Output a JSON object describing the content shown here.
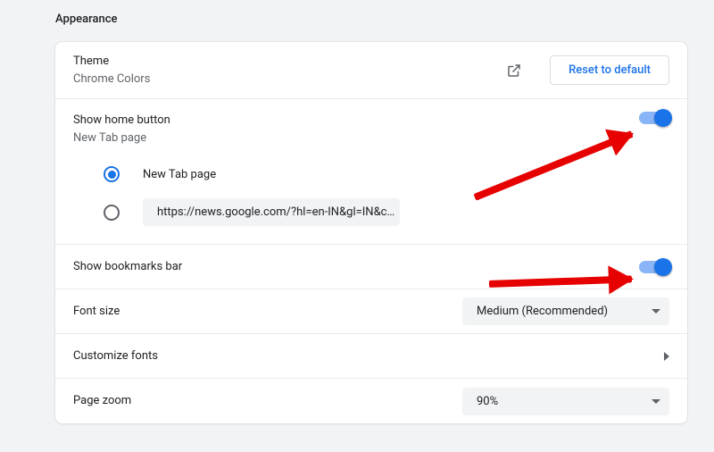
{
  "section_title": "Appearance",
  "theme": {
    "title": "Theme",
    "subtitle": "Chrome Colors",
    "reset_label": "Reset to default"
  },
  "home": {
    "title": "Show home button",
    "subtitle": "New Tab page",
    "toggle_on": true,
    "options": {
      "newtab_label": "New Tab page",
      "url_value": "https://news.google.com/?hl=en-IN&gl=IN&c…",
      "selected": "newtab"
    }
  },
  "bookmarks": {
    "title": "Show bookmarks bar",
    "toggle_on": true
  },
  "fontsize": {
    "title": "Font size",
    "value": "Medium (Recommended)"
  },
  "customize_fonts": {
    "title": "Customize fonts"
  },
  "zoom": {
    "title": "Page zoom",
    "value": "90%"
  }
}
